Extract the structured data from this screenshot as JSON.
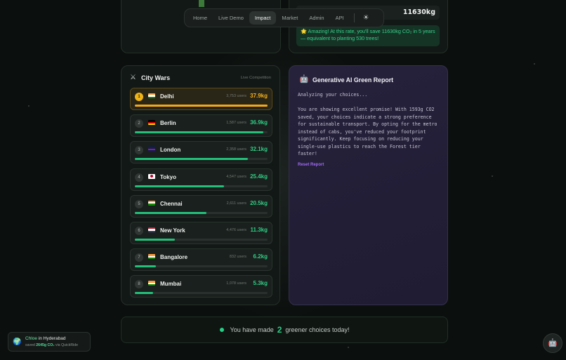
{
  "nav": {
    "items": [
      {
        "label": "Home",
        "active": false
      },
      {
        "label": "Live Demo",
        "active": false
      },
      {
        "label": "Impact",
        "active": true
      },
      {
        "label": "Market",
        "active": false
      },
      {
        "label": "Admin",
        "active": false
      },
      {
        "label": "API",
        "active": false
      }
    ],
    "theme_icon": "sun-icon"
  },
  "impact": {
    "total_saved": "11630kg",
    "message": "🌟 Amazing! At this rate, you'll save 11630kg CO₂ in 5 years — equivalent to planting 530 trees!"
  },
  "city_wars": {
    "icon": "crossed-swords-icon",
    "title": "City Wars",
    "subtitle": "Live Competition",
    "accent_color": "#22c07a",
    "leader_color": "#f2a81a",
    "cities": [
      {
        "rank": "1",
        "flag": "india",
        "name": "Delhi",
        "users": "3,753 users",
        "saved": "37.9kg",
        "progress": 1.0
      },
      {
        "rank": "2",
        "flag": "germany",
        "name": "Berlin",
        "users": "1,587 users",
        "saved": "36.9kg",
        "progress": 0.97
      },
      {
        "rank": "3",
        "flag": "uk",
        "name": "London",
        "users": "2,358 users",
        "saved": "32.1kg",
        "progress": 0.85
      },
      {
        "rank": "4",
        "flag": "japan",
        "name": "Tokyo",
        "users": "4,547 users",
        "saved": "25.4kg",
        "progress": 0.67
      },
      {
        "rank": "5",
        "flag": "india",
        "name": "Chennai",
        "users": "2,611 users",
        "saved": "20.5kg",
        "progress": 0.54
      },
      {
        "rank": "6",
        "flag": "usa",
        "name": "New York",
        "users": "4,476 users",
        "saved": "11.3kg",
        "progress": 0.3
      },
      {
        "rank": "7",
        "flag": "india",
        "name": "Bangalore",
        "users": "832 users",
        "saved": "6.2kg",
        "progress": 0.16
      },
      {
        "rank": "8",
        "flag": "india",
        "name": "Mumbai",
        "users": "1,078 users",
        "saved": "5.3kg",
        "progress": 0.14
      }
    ]
  },
  "ai_report": {
    "icon": "robot-icon",
    "title": "Generative AI Green Report",
    "status": "Analyzing your choices...",
    "body": "You are showing excellent promise! With 1593g CO2 saved, your choices indicate a strong preference for sustainable transport. By opting for the metro instead of cabs, you've reduced your footprint significantly. Keep focusing on reducing your single-use plastics to reach the Forest tier faster!",
    "reset_label": "Reset Report"
  },
  "choices": {
    "prefix": "You have made",
    "count": "2",
    "suffix": "greener choices today!"
  },
  "toast": {
    "icon": "globe-icon",
    "name": "Chloe",
    "in_word": "in",
    "city": "Hyderabad",
    "saved_word": "saved",
    "amount": "2645g CO₂",
    "via": "via QuickRide"
  },
  "chat_button_icon": "robot-icon"
}
